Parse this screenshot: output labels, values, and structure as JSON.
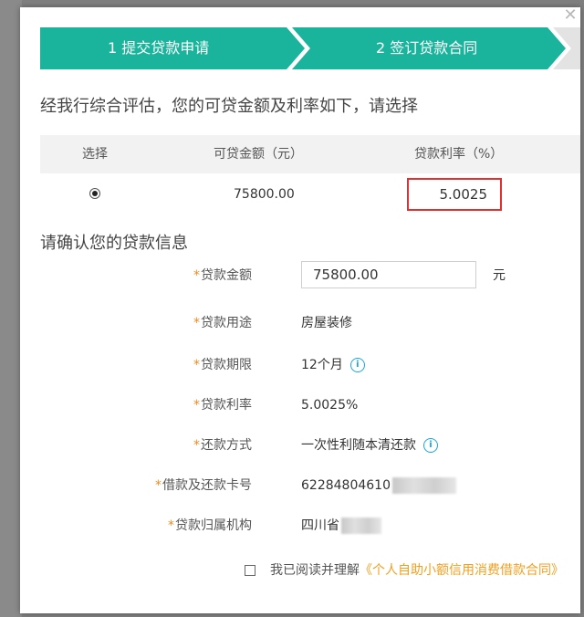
{
  "dialog": {
    "close_icon": "close-icon"
  },
  "steps": [
    {
      "label": "1 提交贷款申请"
    },
    {
      "label": "2 签订贷款合同"
    }
  ],
  "eval_heading": "经我行综合评估，您的可贷金额及利率如下，请选择",
  "offer_table": {
    "headers": {
      "select": "选择",
      "amount": "可贷金额（元）",
      "rate": "贷款利率（%）"
    },
    "row": {
      "selected": true,
      "amount": "75800.00",
      "rate": "5.0025"
    }
  },
  "confirm_heading": "请确认您的贷款信息",
  "form": {
    "amount": {
      "required": "*",
      "label": "贷款金额",
      "value": "75800.00",
      "unit": "元"
    },
    "purpose": {
      "required": "*",
      "label": "贷款用途",
      "value": "房屋装修"
    },
    "term": {
      "required": "*",
      "label": "贷款期限",
      "value": "12个月",
      "icon": "info-icon"
    },
    "rate": {
      "required": "*",
      "label": "贷款利率",
      "value": "5.0025%"
    },
    "repayment": {
      "required": "*",
      "label": "还款方式",
      "value": "一次性利随本清还款",
      "icon": "info-icon"
    },
    "card": {
      "required": "*",
      "label": "借款及还款卡号",
      "value": "62284804610"
    },
    "branch": {
      "required": "*",
      "label": "贷款归属机构",
      "value": "四川省"
    }
  },
  "agreement": {
    "text": "我已阅读并理解",
    "link": "《个人自助小额信用消费借款合同》",
    "checked": false
  },
  "colors": {
    "step_active": "#1ab39c",
    "required": "#f08a20",
    "highlight_border": "#e03030",
    "link": "#f0a020"
  }
}
